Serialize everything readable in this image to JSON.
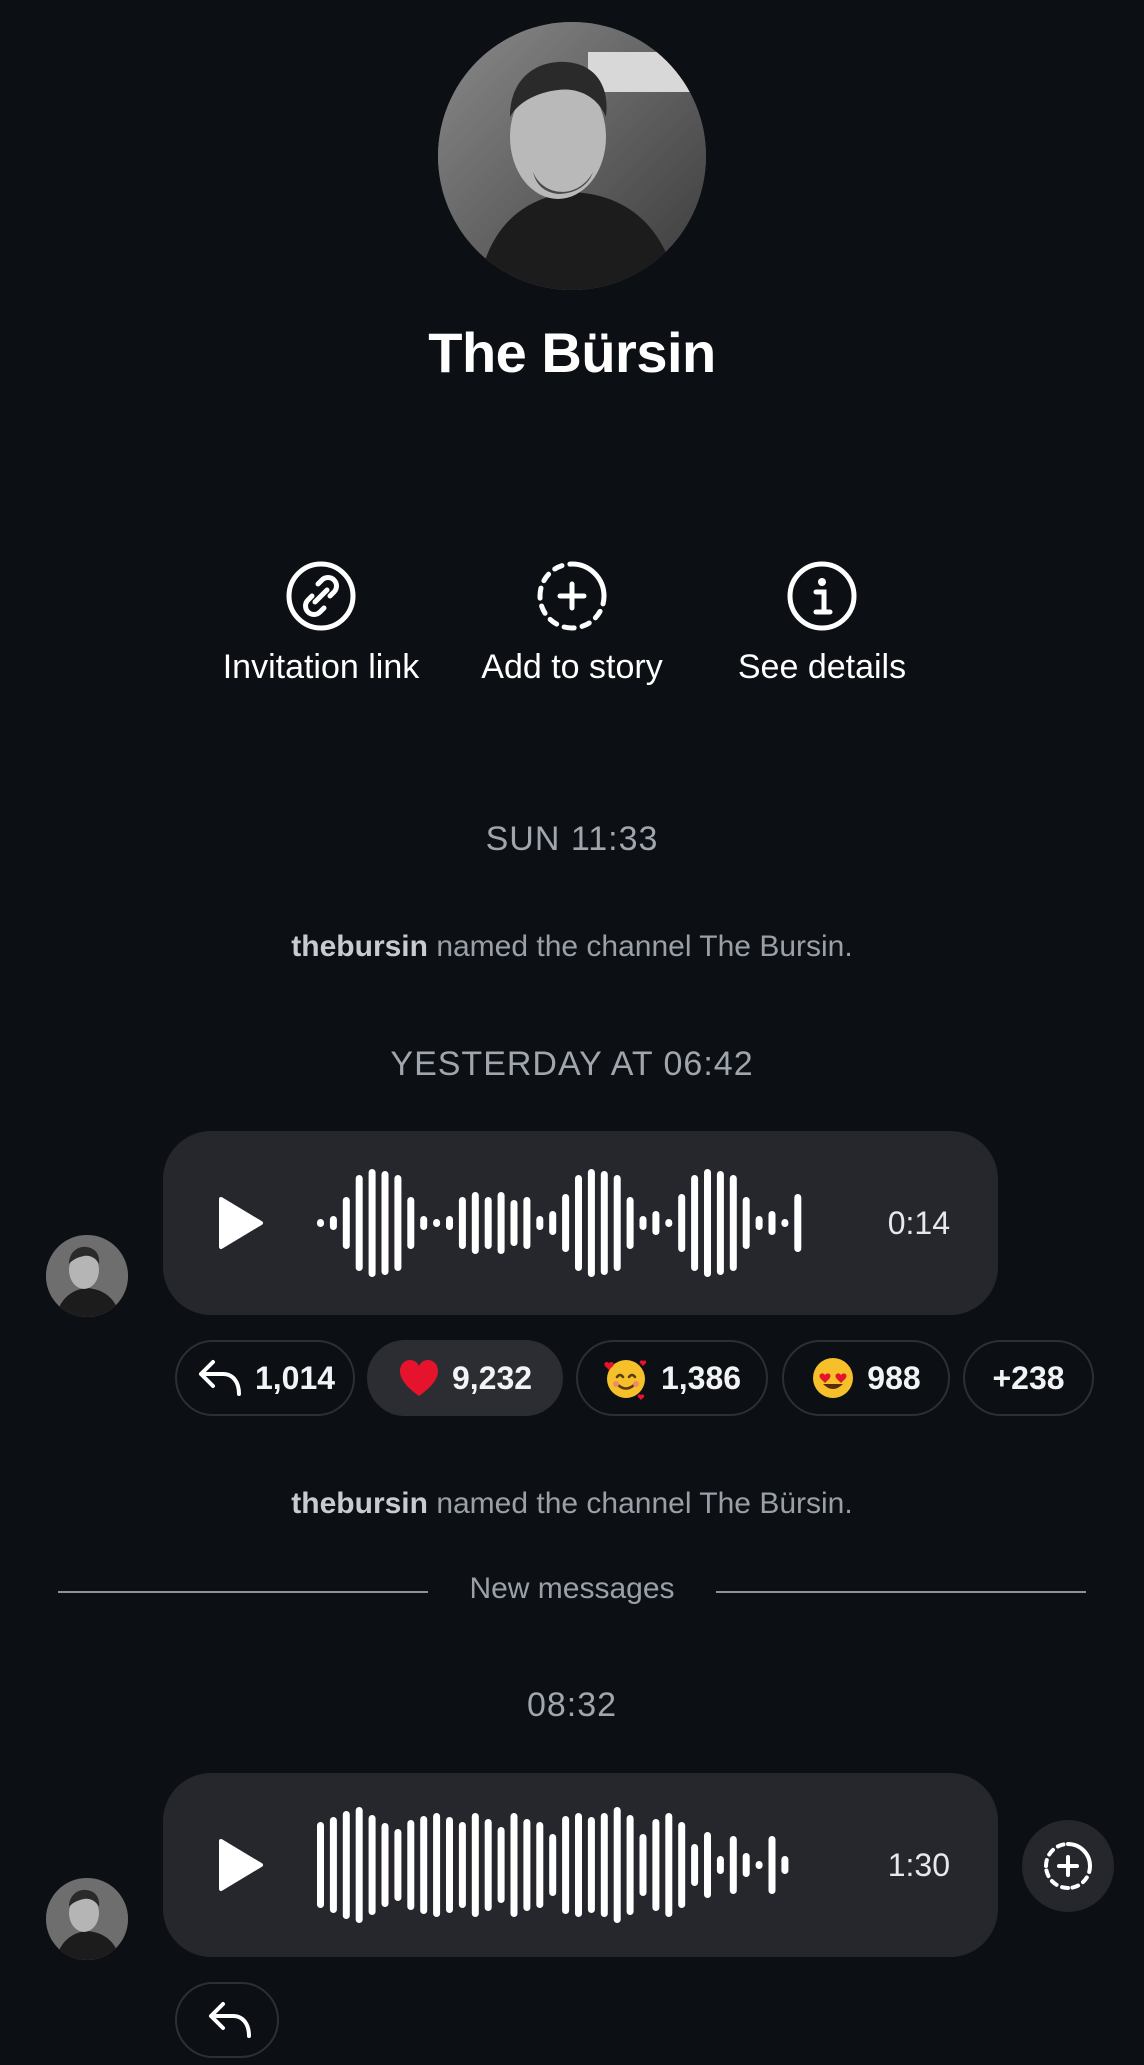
{
  "channel": {
    "title": "The Bürsin"
  },
  "actions": [
    {
      "label": "Invitation link",
      "icon": "link-icon"
    },
    {
      "label": "Add to story",
      "icon": "add-story-icon"
    },
    {
      "label": "See details",
      "icon": "info-icon"
    }
  ],
  "timeline": {
    "date_1": "SUN 11:33",
    "system_1": {
      "user": "thebursin",
      "text": "named the channel The Bursin."
    },
    "date_2": "YESTERDAY AT 06:42",
    "voice_1": {
      "duration": "0:14"
    },
    "reactions": [
      {
        "icon": "reply-icon",
        "count": "1,014"
      },
      {
        "icon": "red-heart-emoji",
        "count": "9,232"
      },
      {
        "icon": "smiling-face-with-hearts-emoji",
        "count": "1,386"
      },
      {
        "icon": "heart-eyes-emoji",
        "count": "988"
      },
      {
        "icon": "",
        "count": "+238"
      }
    ],
    "system_2": {
      "user": "thebursin",
      "text": "named the channel The Bürsin."
    },
    "new_messages": "New messages",
    "date_3": "08:32",
    "voice_2": {
      "duration": "1:30"
    }
  },
  "colors": {
    "background": "#0c0f13",
    "bubble": "#25272c",
    "secondary_text": "#9aa0a8",
    "heart": "#e5132b"
  }
}
